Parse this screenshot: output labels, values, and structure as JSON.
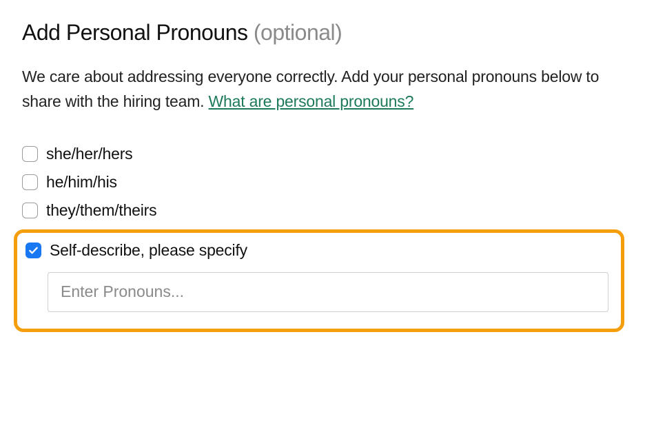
{
  "heading": {
    "main": "Add Personal Pronouns",
    "optional": "(optional)"
  },
  "description": {
    "text_before_link": "We care about addressing everyone correctly. Add your personal pronouns below to share with the hiring team. ",
    "link_text": "What are personal pronouns?"
  },
  "options": [
    {
      "label": "she/her/hers",
      "checked": false
    },
    {
      "label": "he/him/his",
      "checked": false
    },
    {
      "label": "they/them/theirs",
      "checked": false
    },
    {
      "label": "Self-describe, please specify",
      "checked": true
    }
  ],
  "self_describe_input": {
    "placeholder": "Enter Pronouns...",
    "value": ""
  }
}
